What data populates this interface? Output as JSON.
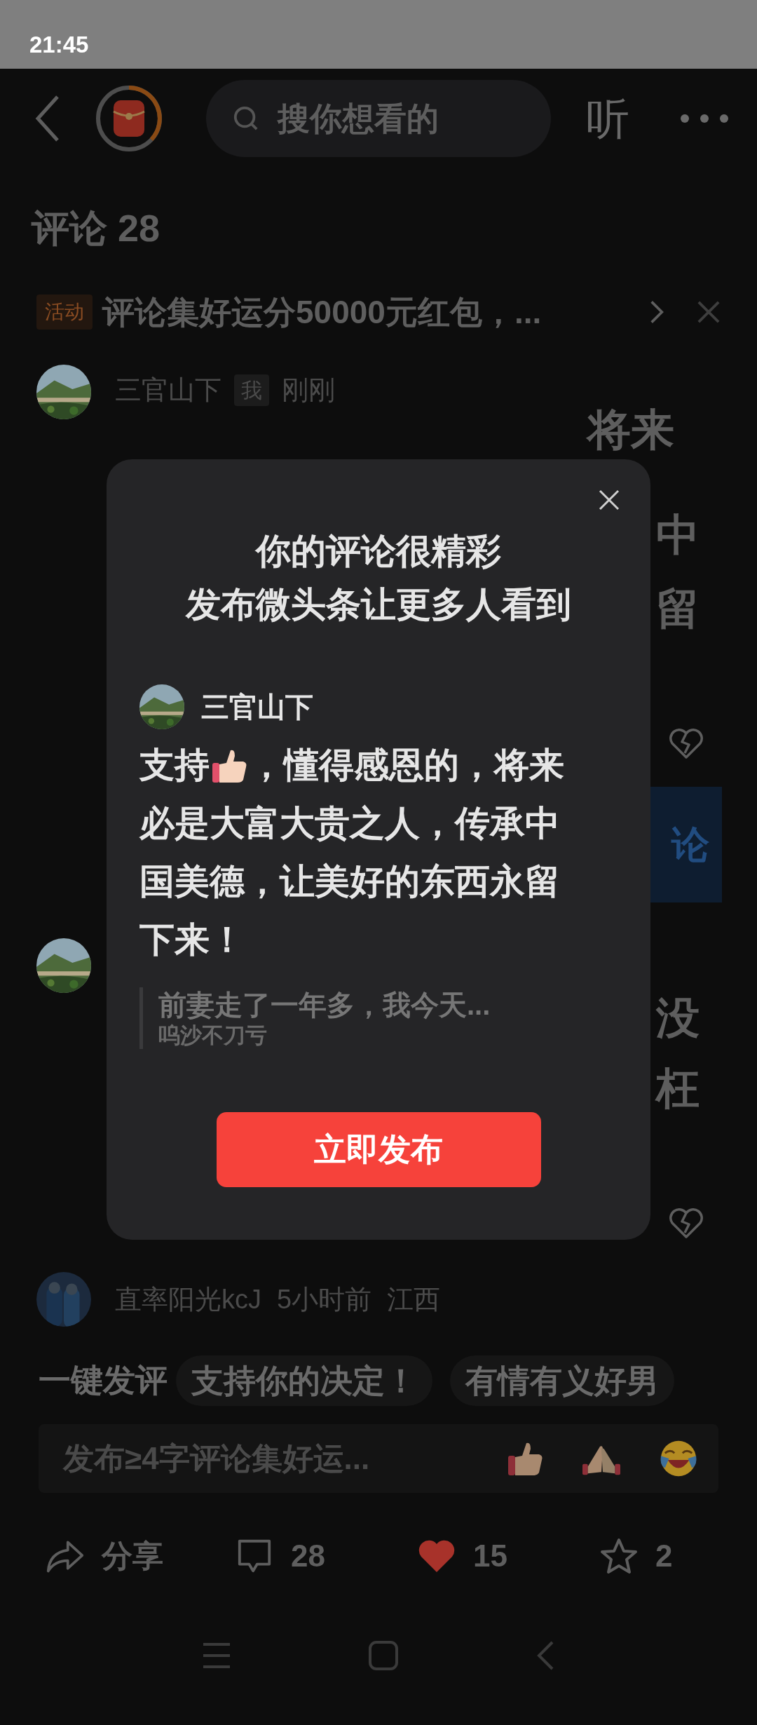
{
  "status_bar": {
    "time": "21:45"
  },
  "header": {
    "search": {
      "placeholder": "搜你想看的"
    },
    "listen": "听"
  },
  "comments_title": "评论 28",
  "activity": {
    "tag": "活动",
    "text": "评论集好运分50000元红包，..."
  },
  "comments": [
    {
      "author": "三官山下",
      "badge": "我",
      "time": "刚刚",
      "fragments": [
        "将来",
        "中",
        "留"
      ],
      "action": "论"
    },
    {
      "fragments": [
        "没",
        "枉"
      ]
    },
    {
      "author": "直率阳光kcJ",
      "time": "5小时前",
      "location": "江西"
    }
  ],
  "quick_replies": {
    "label": "一键发评",
    "chips": [
      "支持你的决定！",
      "有情有义好男"
    ]
  },
  "input": {
    "placeholder": "发布≥4字评论集好运..."
  },
  "actions": [
    {
      "kind": "share",
      "label": "分享"
    },
    {
      "kind": "comment",
      "label": "28"
    },
    {
      "kind": "like",
      "label": "15",
      "selected": true
    },
    {
      "kind": "favorite",
      "label": "2",
      "selected": false
    }
  ],
  "dialog": {
    "title_lines": [
      "你的评论很精彩",
      "发布微头条让更多人看到"
    ],
    "author": "三官山下",
    "segments": [
      {
        "kind": "text",
        "text": "支持"
      },
      {
        "kind": "emoji"
      },
      {
        "kind": "text",
        "text": "，懂得感恩的，将来"
      },
      {
        "kind": "block",
        "text": "必是大富大贵之人，传承中国美德，让美好的东西永留下来！"
      }
    ],
    "quote": {
      "text": "前妻走了一年多，我今天...",
      "author": "呜沙不刀亏"
    },
    "button": "立即发布"
  }
}
